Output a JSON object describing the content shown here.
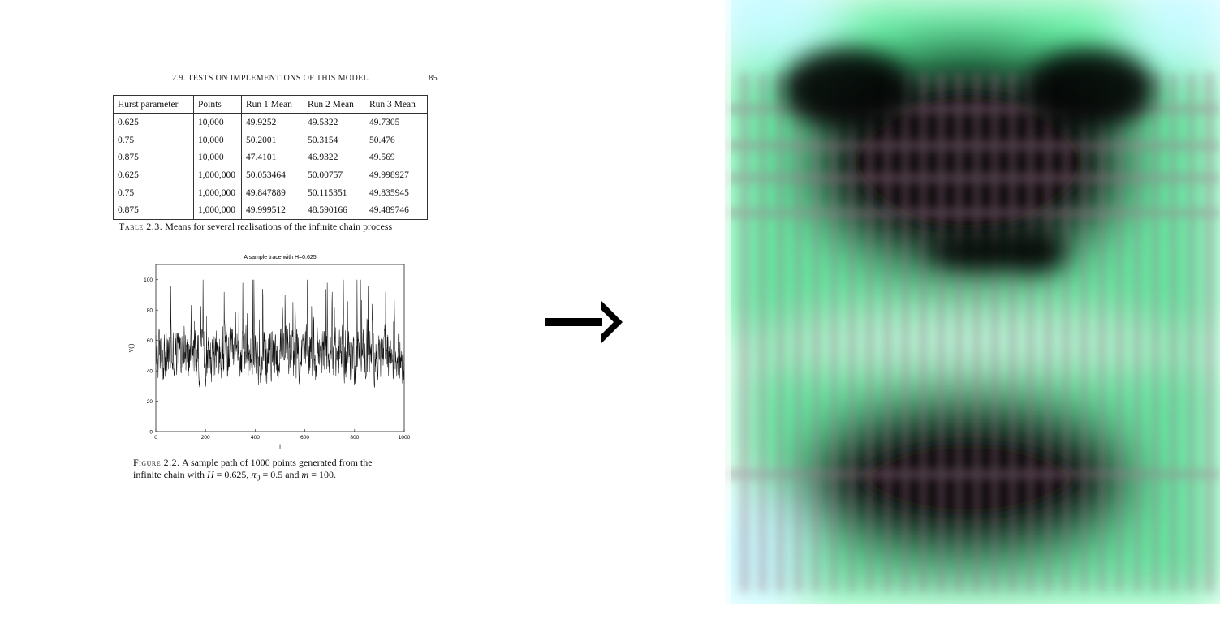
{
  "page": {
    "running_head": "2.9. TESTS ON IMPLEMENTIONS OF THIS MODEL",
    "page_number": "85"
  },
  "table": {
    "headers": [
      "Hurst parameter",
      "Points",
      "Run 1 Mean",
      "Run 2 Mean",
      "Run 3 Mean"
    ],
    "rows": [
      [
        "0.625",
        "10,000",
        "49.9252",
        "49.5322",
        "49.7305"
      ],
      [
        "0.75",
        "10,000",
        "50.2001",
        "50.3154",
        "50.476"
      ],
      [
        "0.875",
        "10,000",
        "47.4101",
        "46.9322",
        "49.569"
      ],
      [
        "0.625",
        "1,000,000",
        "50.053464",
        "50.00757",
        "49.998927"
      ],
      [
        "0.75",
        "1,000,000",
        "49.847889",
        "50.115351",
        "49.835945"
      ],
      [
        "0.875",
        "1,000,000",
        "49.999512",
        "48.590166",
        "49.489746"
      ]
    ],
    "caption_label": "Table 2.3.",
    "caption_text": "Means for several realisations of the infinite chain process"
  },
  "chart_data": {
    "type": "line",
    "title": "A sample trace with H=0.625",
    "xlabel": "i",
    "ylabel": "Y(i)",
    "xlim": [
      0,
      1000
    ],
    "ylim": [
      0,
      110
    ],
    "xticks": [
      0,
      200,
      400,
      600,
      800,
      1000
    ],
    "yticks": [
      0,
      20,
      40,
      60,
      80,
      100
    ],
    "n_points": 1000,
    "series": [
      {
        "approx_mean": 50,
        "approx_min": 29,
        "approx_max": 100,
        "peaks": [
          {
            "x": 60,
            "y": 96
          },
          {
            "x": 190,
            "y": 100
          },
          {
            "x": 275,
            "y": 92
          },
          {
            "x": 350,
            "y": 98
          },
          {
            "x": 390,
            "y": 100
          },
          {
            "x": 395,
            "y": 100
          },
          {
            "x": 430,
            "y": 94
          },
          {
            "x": 520,
            "y": 90
          },
          {
            "x": 560,
            "y": 96
          },
          {
            "x": 610,
            "y": 100
          },
          {
            "x": 690,
            "y": 98
          },
          {
            "x": 710,
            "y": 92
          },
          {
            "x": 755,
            "y": 100
          },
          {
            "x": 810,
            "y": 100
          },
          {
            "x": 855,
            "y": 96
          },
          {
            "x": 925,
            "y": 92
          },
          {
            "x": 960,
            "y": 88
          }
        ]
      }
    ]
  },
  "figure": {
    "caption_label": "Figure 2.2.",
    "caption_line1": "A sample path of 1000 points generated from the",
    "caption_line2_a": "infinite chain with ",
    "caption_H": "H",
    "caption_eq1": " = 0.625, ",
    "caption_pi": "π",
    "caption_pi_sub": "0",
    "caption_eq2": " = 0.5 and ",
    "caption_m": "m",
    "caption_eq3": " = 100."
  },
  "render": {
    "colors": {
      "dark": "#000000",
      "green": "#5cf0a0",
      "cyan": "#bff8ff",
      "mauve": "#a07a90",
      "white": "#ffffff"
    }
  }
}
